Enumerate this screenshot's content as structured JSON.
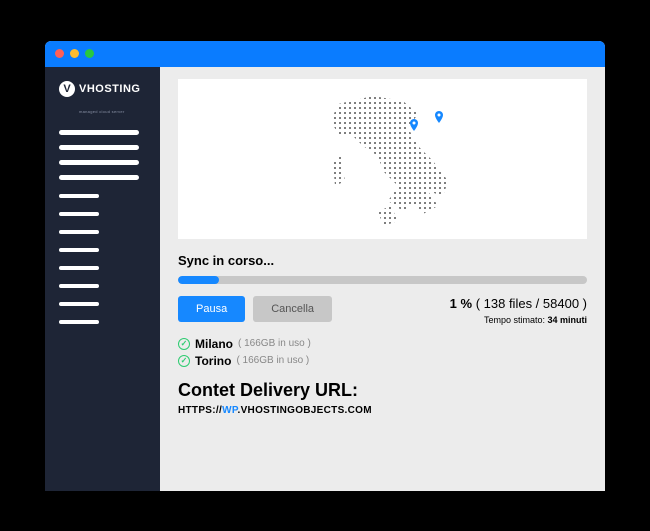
{
  "brand": {
    "name": "VHOSTING",
    "tagline": "managed cloud server"
  },
  "sync": {
    "title": "Sync in corso...",
    "percent": "1 %",
    "detail": "( 138 files / 58400 )",
    "eta_label": "Tempo stimato:",
    "eta_value": "34 minuti",
    "pause": "Pausa",
    "cancel": "Cancella"
  },
  "locations": [
    {
      "name": "Milano",
      "usage": "( 166GB in uso )"
    },
    {
      "name": "Torino",
      "usage": "( 166GB in uso )"
    }
  ],
  "cdn": {
    "title": "Contet Delivery URL:",
    "prefix": "HTTPS://",
    "hl": "WP",
    "suffix": ".VHOSTINGOBJECTS.COM"
  }
}
